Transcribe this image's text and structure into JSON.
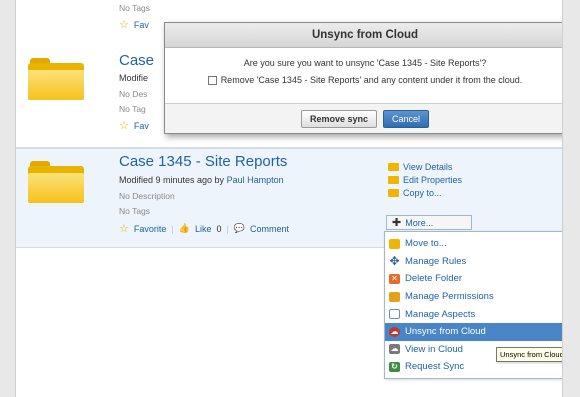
{
  "top_item": {
    "title_partial": "Case",
    "modified_partial": "Modifie",
    "tags_top": "No Tags",
    "favorite_top": "Fav",
    "desc_partial": "No Des",
    "tags_partial": "No Tag",
    "favorite_partial": "Fav"
  },
  "dialog": {
    "title": "Unsync from Cloud",
    "question": "Are you sure you want to unsync 'Case 1345 - Site Reports'?",
    "checkbox_label": "Remove 'Case 1345 - Site Reports' and any content under it from the cloud.",
    "remove_button": "Remove sync",
    "cancel_button": "Cancel"
  },
  "main_item": {
    "title": "Case 1345 - Site Reports",
    "modified_prefix": "Modified 9 minutes ago by",
    "modified_user": "Paul Hampton",
    "description": "No Description",
    "tags": "No Tags",
    "favorite": "Favorite",
    "like": "Like",
    "like_count": "0",
    "comment": "Comment"
  },
  "side_actions": {
    "view_details": "View Details",
    "edit_properties": "Edit Properties",
    "copy_to": "Copy to...",
    "more": "More..."
  },
  "menu": {
    "items": [
      {
        "label": "Move to...",
        "icon": "folder-icon"
      },
      {
        "label": "Manage Rules",
        "icon": "rules-icon"
      },
      {
        "label": "Delete Folder",
        "icon": "delete-icon"
      },
      {
        "label": "Manage Permissions",
        "icon": "permissions-icon"
      },
      {
        "label": "Manage Aspects",
        "icon": "aspects-icon"
      },
      {
        "label": "Unsync from Cloud",
        "icon": "cloud-icon"
      },
      {
        "label": "View in Cloud",
        "icon": "view-cloud-icon"
      },
      {
        "label": "Request Sync",
        "icon": "sync-icon"
      }
    ],
    "active_index": 5
  },
  "tooltip": "Unsync from Cloud"
}
